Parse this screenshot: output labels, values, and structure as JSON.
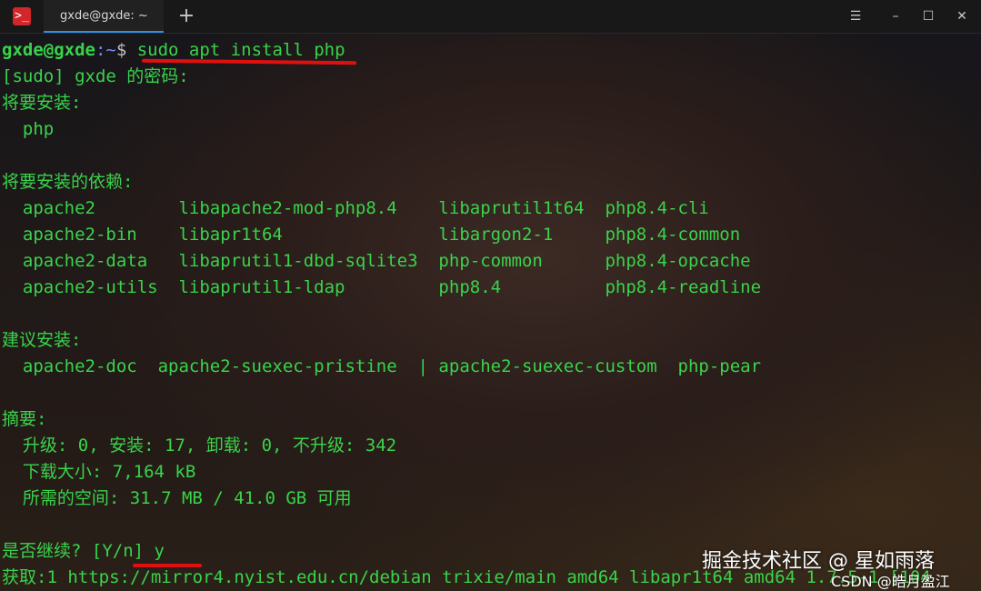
{
  "window": {
    "tab_title": "gxde@gxde: ~",
    "new_tab_glyph": "+",
    "app_icon_glyph": ">_",
    "controls": {
      "menu": "☰",
      "minimize": "–",
      "maximize": "☐",
      "close": "✕"
    }
  },
  "terminal": {
    "prompt_user": "gxde@gxde",
    "prompt_path": ":~",
    "prompt_dollar": "$ ",
    "command": "sudo apt install php",
    "lines": [
      "[sudo] gxde 的密码:",
      "将要安装:",
      "  php",
      "",
      "将要安装的依赖:",
      "  apache2        libapache2-mod-php8.4    libaprutil1t64  php8.4-cli",
      "  apache2-bin    libapr1t64               libargon2-1     php8.4-common",
      "  apache2-data   libaprutil1-dbd-sqlite3  php-common      php8.4-opcache",
      "  apache2-utils  libaprutil1-ldap         php8.4          php8.4-readline",
      "",
      "建议安装:",
      "  apache2-doc  apache2-suexec-pristine  | apache2-suexec-custom  php-pear",
      "",
      "摘要:",
      "  升级: 0, 安装: 17, 卸载: 0, 不升级: 342",
      "  下载大小: 7,164 kB",
      "  所需的空间: 31.7 MB / 41.0 GB 可用",
      "",
      "是否继续? [Y/n] y",
      "获取:1 https://mirror4.nyist.edu.cn/debian trixie/main amd64 libapr1t64 amd64 1.7.5-1 [104"
    ]
  },
  "watermarks": {
    "juejin": "掘金技术社区 @ 星如雨落",
    "csdn": "CSDN @皓月盈江"
  }
}
